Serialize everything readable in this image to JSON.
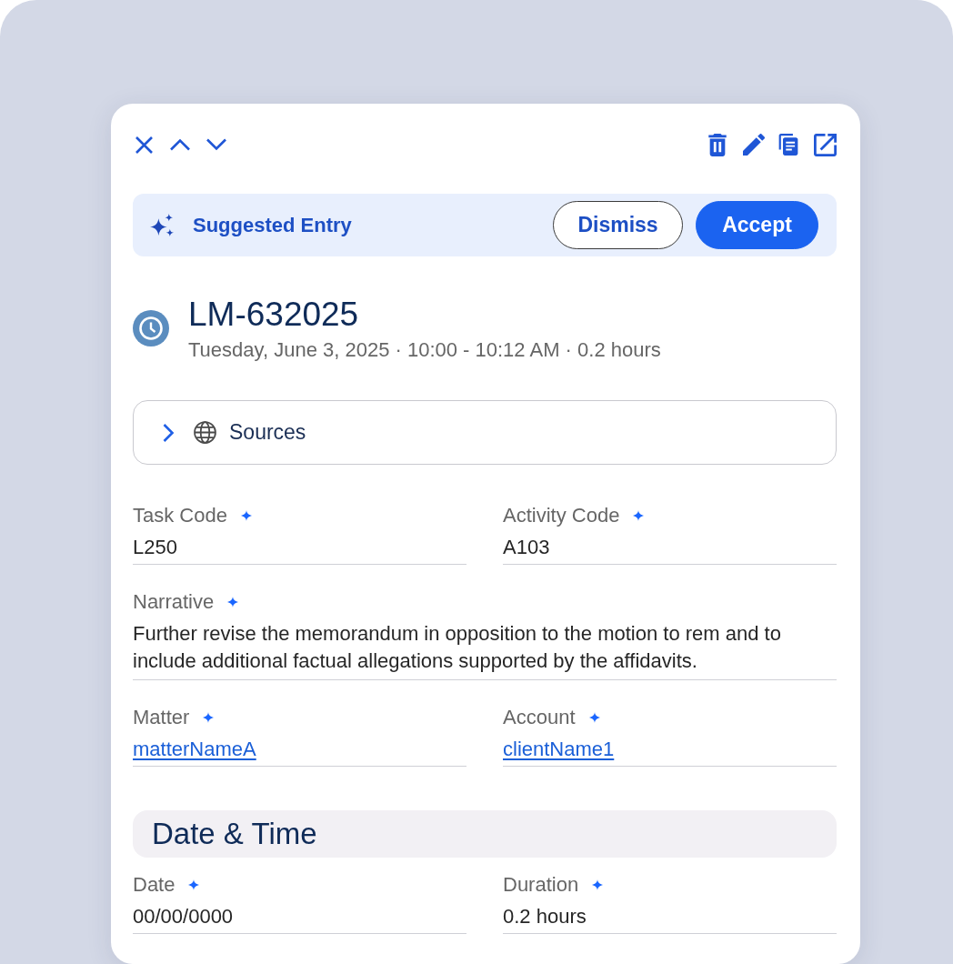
{
  "suggestion": {
    "title": "Suggested Entry",
    "buttons": [
      {
        "kind": "dismiss",
        "label": "Dismiss"
      },
      {
        "kind": "accept",
        "label": "Accept"
      }
    ]
  },
  "entry": {
    "title": "LM-632025",
    "subtitle": "Tuesday, June 3, 2025 · 10:00 - 10:12 AM · 0.2 hours"
  },
  "sources": {
    "label": "Sources",
    "expanded": false
  },
  "sections": [
    {
      "rows": [
        [
          {
            "label": "Task Code",
            "suggested": true,
            "kind": "text",
            "value": "L250"
          },
          {
            "label": "Activity Code",
            "suggested": true,
            "kind": "text",
            "value": "A103"
          }
        ],
        [
          {
            "label": "Narrative",
            "suggested": true,
            "kind": "multiline",
            "value": "Further revise the memorandum in opposition to the motion to rem and to include additional factual allegations supported by the affidavits."
          }
        ],
        [
          {
            "label": "Matter",
            "suggested": true,
            "kind": "link",
            "value": "matterNameA"
          },
          {
            "label": "Account",
            "suggested": true,
            "kind": "link",
            "value": "clientName1"
          }
        ]
      ]
    },
    {
      "title": "Date & Time",
      "rows": [
        [
          {
            "label": "Date",
            "suggested": true,
            "kind": "text",
            "value": "00/00/0000"
          },
          {
            "label": "Duration",
            "suggested": true,
            "kind": "text",
            "value": "0.2 hours"
          }
        ]
      ]
    }
  ]
}
